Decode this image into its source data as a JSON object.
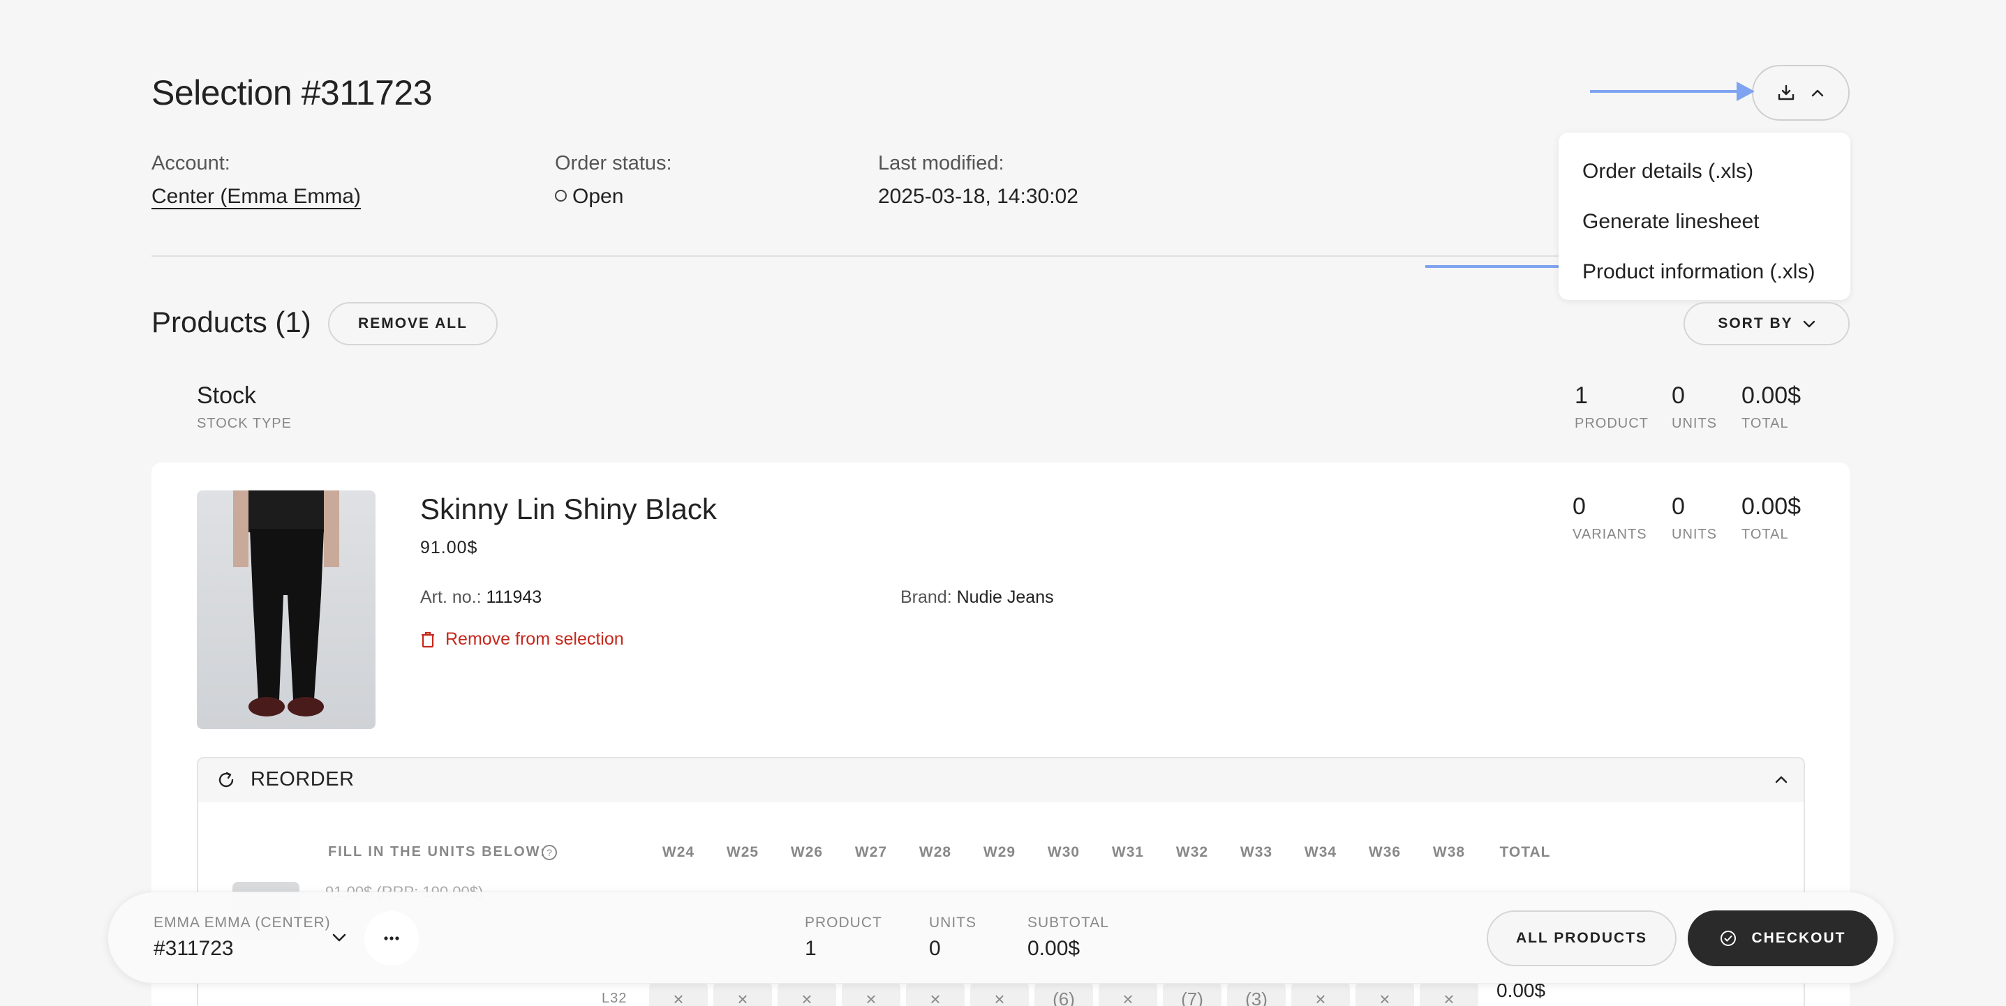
{
  "header": {
    "title": "Selection #311723",
    "account_label": "Account:",
    "account_value": "Center (Emma Emma)",
    "status_label": "Order status:",
    "status_value": "Open",
    "modified_label": "Last modified:",
    "modified_value": "2025-03-18, 14:30:02"
  },
  "export_menu": {
    "items": [
      "Order details (.xls)",
      "Generate linesheet",
      "Product information (.xls)"
    ]
  },
  "products": {
    "title": "Products (1)",
    "remove_all": "REMOVE ALL",
    "sort_by": "SORT BY"
  },
  "stock": {
    "title": "Stock",
    "subtitle": "STOCK TYPE",
    "product_count": "1",
    "product_label": "PRODUCT",
    "units": "0",
    "units_label": "UNITS",
    "total": "0.00$",
    "total_label": "TOTAL"
  },
  "product": {
    "name": "Skinny Lin Shiny Black",
    "price": "91.00$",
    "art_label": "Art. no.:",
    "art_value": "111943",
    "brand_label": "Brand:",
    "brand_value": "Nudie Jeans",
    "remove_label": "Remove from selection",
    "variants": "0",
    "variants_label": "VARIANTS",
    "units": "0",
    "units_label": "UNITS",
    "total": "0.00$",
    "total_label": "TOTAL"
  },
  "reorder": {
    "title": "REORDER",
    "fill_label": "FILL IN THE UNITS BELOW:",
    "weeks": [
      "W24",
      "W25",
      "W26",
      "W27",
      "W28",
      "W29",
      "W30",
      "W31",
      "W32",
      "W33",
      "W34",
      "W36",
      "W38"
    ],
    "total_label": "TOTAL",
    "row_partial_price": "91.00$ (RRP: 190.00$)",
    "row_size": "L32",
    "row_cells": [
      "×",
      "×",
      "×",
      "×",
      "×",
      "×",
      "(6)",
      "×",
      "(7)",
      "(3)",
      "×",
      "×",
      "×"
    ],
    "row_total": "0.00$"
  },
  "bottom_bar": {
    "customer": "EMMA EMMA (CENTER)",
    "selection": "#311723",
    "product_label": "PRODUCT",
    "product_value": "1",
    "units_label": "UNITS",
    "units_value": "0",
    "subtotal_label": "SUBTOTAL",
    "subtotal_value": "0.00$",
    "all_products": "ALL PRODUCTS",
    "checkout": "CHECKOUT"
  },
  "colors": {
    "accent_arrow": "#7ea3f0",
    "danger": "#c5281c",
    "checkout_bg": "#2a2a2a"
  }
}
